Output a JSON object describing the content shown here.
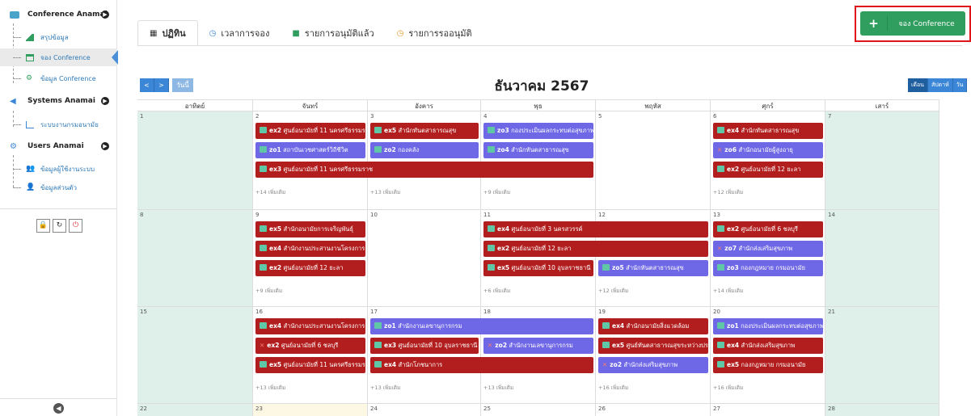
{
  "sidebar": {
    "groups": [
      {
        "label": "Conference Anamai",
        "icon": "video-icon"
      },
      {
        "label": "Systems Anamai",
        "icon": "megaphone-icon"
      },
      {
        "label": "Users Anamai",
        "icon": "gears-icon"
      }
    ],
    "items": [
      {
        "label": "สรุปข้อมูล",
        "icon": "area-chart-icon"
      },
      {
        "label": "จอง Conference",
        "icon": "calendar-icon"
      },
      {
        "label": "ข้อมูล Conference",
        "icon": "gears-icon"
      },
      {
        "label": "ระบบงานกรมอนามัย",
        "icon": "bar-chart-icon"
      },
      {
        "label": "ข้อมูลผู้ใช้งานระบบ",
        "icon": "users-icon"
      },
      {
        "label": "ข้อมูลส่วนตัว",
        "icon": "user-icon"
      }
    ],
    "tools": [
      "lock-icon",
      "refresh-icon",
      "power-icon"
    ]
  },
  "tabs": [
    {
      "label": "ปฏิทิน",
      "icon": "calendar-icon"
    },
    {
      "label": "เวลาการจอง",
      "icon": "clock-icon"
    },
    {
      "label": "รายการอนุมัติแล้ว",
      "icon": "video-icon"
    },
    {
      "label": "รายการรออนุมัติ",
      "icon": "clock-icon"
    }
  ],
  "book_button": {
    "plus": "+",
    "label": "จอง Conference",
    "color": "#2f9e5f"
  },
  "nav": {
    "prev": "<",
    "next": ">",
    "today": "วันนี้"
  },
  "calendar_title": "ธันวาคม 2567",
  "views": [
    "เดือน",
    "สัปดาห์",
    "วัน"
  ],
  "weekdays": [
    "อาทิตย์",
    "จันทร์",
    "อังคาร",
    "พุธ",
    "พฤหัส",
    "ศุกร์",
    "เสาร์"
  ],
  "weeks": [
    {
      "days": [
        "1",
        "2",
        "3",
        "4",
        "5",
        "6",
        "7"
      ],
      "more": [
        "",
        "+14 เพิ่มเติม",
        "+13 เพิ่มเติม",
        "+9 เพิ่มเติม",
        "",
        "+12 เพิ่มเติม",
        ""
      ],
      "events": [
        {
          "code": "ex2",
          "text": "ศูนย์อนามัยที่ 11 นครศรีธรรมราช",
          "day": 1,
          "span": 1,
          "row": 0,
          "color": "r",
          "icon": "video"
        },
        {
          "code": "ex5",
          "text": "สำนักทันตสาธารณสุข",
          "day": 2,
          "span": 1,
          "row": 0,
          "color": "r",
          "icon": "video"
        },
        {
          "code": "zo3",
          "text": "กองประเมินผลกระทบต่อสุขภาพ",
          "day": 3,
          "span": 1,
          "row": 0,
          "color": "p",
          "icon": "video"
        },
        {
          "code": "ex4",
          "text": "สำนักทันตสาธารณสุข",
          "day": 5,
          "span": 1,
          "row": 0,
          "color": "r",
          "icon": "video"
        },
        {
          "code": "zo1",
          "text": "สถาบันเวชศาสตร์วิถีชีวิต",
          "day": 1,
          "span": 1,
          "row": 1,
          "color": "p",
          "icon": "video"
        },
        {
          "code": "zo2",
          "text": "กองคลัง",
          "day": 2,
          "span": 1,
          "row": 1,
          "color": "p",
          "icon": "video"
        },
        {
          "code": "zo4",
          "text": "สำนักทันตสาธารณสุข",
          "day": 3,
          "span": 1,
          "row": 1,
          "color": "p",
          "icon": "video"
        },
        {
          "code": "zo6",
          "text": "สำนักอนามัยผู้สูงอายุ",
          "day": 5,
          "span": 1,
          "row": 1,
          "color": "p",
          "icon": "cancel"
        },
        {
          "code": "ex3",
          "text": "ศูนย์อนามัยที่ 11 นครศรีธรรมราช",
          "day": 1,
          "span": 3,
          "row": 2,
          "color": "r",
          "icon": "video"
        },
        {
          "code": "ex2",
          "text": "ศูนย์อนามัยที่ 12 ยะลา",
          "day": 5,
          "span": 1,
          "row": 2,
          "color": "r",
          "icon": "video"
        }
      ]
    },
    {
      "days": [
        "8",
        "9",
        "10",
        "11",
        "12",
        "13",
        "14"
      ],
      "more": [
        "",
        "+9 เพิ่มเติม",
        "",
        "+6 เพิ่มเติม",
        "+12 เพิ่มเติม",
        "+14 เพิ่มเติม",
        ""
      ],
      "events": [
        {
          "code": "ex5",
          "text": "สำนักอนามัยการเจริญพันธุ์",
          "day": 1,
          "span": 1,
          "row": 0,
          "color": "r",
          "icon": "video"
        },
        {
          "code": "ex4",
          "text": "ศูนย์อนามัยที่ 3 นครสวรรค์",
          "day": 3,
          "span": 2,
          "row": 0,
          "color": "r",
          "icon": "video"
        },
        {
          "code": "ex2",
          "text": "ศูนย์อนามัยที่ 6 ชลบุรี",
          "day": 5,
          "span": 1,
          "row": 0,
          "color": "r",
          "icon": "video"
        },
        {
          "code": "ex4",
          "text": "สำนักงานประสานงานโครงการ",
          "day": 1,
          "span": 1,
          "row": 1,
          "color": "r",
          "icon": "video"
        },
        {
          "code": "ex2",
          "text": "ศูนย์อนามัยที่ 12 ยะลา",
          "day": 3,
          "span": 2,
          "row": 1,
          "color": "r",
          "icon": "video"
        },
        {
          "code": "zo7",
          "text": "สำนักส่งเสริมสุขภาพ",
          "day": 5,
          "span": 1,
          "row": 1,
          "color": "p",
          "icon": "cancel"
        },
        {
          "code": "ex2",
          "text": "ศูนย์อนามัยที่ 12 ยะลา",
          "day": 1,
          "span": 1,
          "row": 2,
          "color": "r",
          "icon": "video"
        },
        {
          "code": "ex5",
          "text": "ศูนย์อนามัยที่ 10 อุบลราชธานี",
          "day": 3,
          "span": 1,
          "row": 2,
          "color": "r",
          "icon": "video"
        },
        {
          "code": "zo5",
          "text": "สำนักทันตสาธารณสุข",
          "day": 4,
          "span": 1,
          "row": 2,
          "color": "p",
          "icon": "video"
        },
        {
          "code": "zo3",
          "text": "กองกฎหมาย กรมอนามัย",
          "day": 5,
          "span": 1,
          "row": 2,
          "color": "p",
          "icon": "video"
        }
      ]
    },
    {
      "days": [
        "15",
        "16",
        "17",
        "18",
        "19",
        "20",
        "21"
      ],
      "more": [
        "",
        "+13 เพิ่มเติม",
        "+13 เพิ่มเติม",
        "+13 เพิ่มเติม",
        "+16 เพิ่มเติม",
        "+16 เพิ่มเติม",
        ""
      ],
      "events": [
        {
          "code": "ex4",
          "text": "สำนักงานประสานงานโครงการ",
          "day": 1,
          "span": 1,
          "row": 0,
          "color": "r",
          "icon": "video"
        },
        {
          "code": "zo1",
          "text": "สำนักงานเลขานุการกรม",
          "day": 2,
          "span": 2,
          "row": 0,
          "color": "p",
          "icon": "video"
        },
        {
          "code": "ex4",
          "text": "สำนักอนามัยสิ่งแวดล้อม",
          "day": 4,
          "span": 1,
          "row": 0,
          "color": "r",
          "icon": "video"
        },
        {
          "code": "zo1",
          "text": "กองประเมินผลกระทบต่อสุขภาพ",
          "day": 5,
          "span": 1,
          "row": 0,
          "color": "p",
          "icon": "video"
        },
        {
          "code": "ex2",
          "text": "ศูนย์อนามัยที่ 6 ชลบุรี",
          "day": 1,
          "span": 1,
          "row": 1,
          "color": "r",
          "icon": "cancel"
        },
        {
          "code": "ex3",
          "text": "ศูนย์อนามัยที่ 10 อุบลราชธานี",
          "day": 2,
          "span": 1,
          "row": 1,
          "color": "r",
          "icon": "video"
        },
        {
          "code": "zo2",
          "text": "สำนักงานเลขานุการกรม",
          "day": 3,
          "span": 1,
          "row": 1,
          "color": "p",
          "icon": "cancel"
        },
        {
          "code": "ex5",
          "text": "ศูนย์ทันตสาธารณสุขระหว่างประเทศ",
          "day": 4,
          "span": 1,
          "row": 1,
          "color": "r",
          "icon": "video"
        },
        {
          "code": "ex4",
          "text": "สำนักส่งเสริมสุขภาพ",
          "day": 5,
          "span": 1,
          "row": 1,
          "color": "r",
          "icon": "video"
        },
        {
          "code": "ex5",
          "text": "ศูนย์อนามัยที่ 11 นครศรีธรรมราช",
          "day": 1,
          "span": 1,
          "row": 2,
          "color": "r",
          "icon": "video"
        },
        {
          "code": "ex4",
          "text": "สำนักโภชนาการ",
          "day": 2,
          "span": 2,
          "row": 2,
          "color": "r",
          "icon": "video"
        },
        {
          "code": "zo2",
          "text": "สำนักส่งเสริมสุขภาพ",
          "day": 4,
          "span": 1,
          "row": 2,
          "color": "p",
          "icon": "cancel"
        },
        {
          "code": "ex5",
          "text": "กองกฎหมาย กรมอนามัย",
          "day": 5,
          "span": 1,
          "row": 2,
          "color": "r",
          "icon": "video"
        }
      ]
    },
    {
      "days": [
        "22",
        "23",
        "24",
        "25",
        "26",
        "27",
        "28"
      ],
      "more": [
        "",
        "",
        "",
        "",
        "",
        "",
        ""
      ],
      "events": []
    }
  ],
  "colors": {
    "accent": "#3b86d6",
    "approved": "#b21e1e",
    "zoom": "#6f68e6",
    "weekend": "#dff0ea",
    "today": "#fcf8e3",
    "highlight": "#e0151a"
  }
}
